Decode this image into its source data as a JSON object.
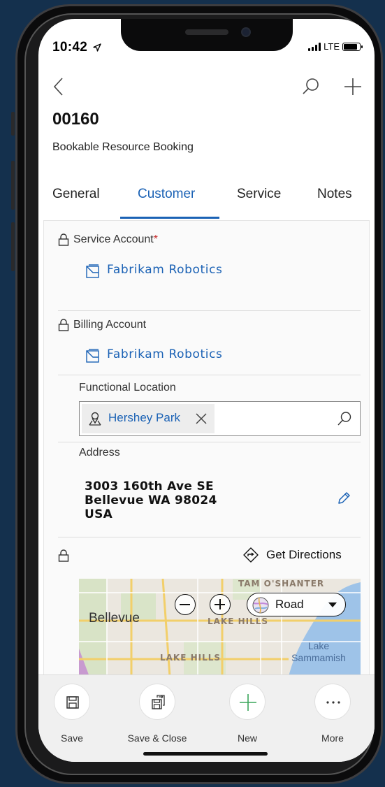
{
  "status_bar": {
    "time": "10:42",
    "network": "LTE",
    "battery_fill": 0.85
  },
  "header": {
    "record_title": "00160",
    "entity_name": "Bookable Resource Booking"
  },
  "tabs": [
    {
      "label": "General"
    },
    {
      "label": "Customer",
      "active": true
    },
    {
      "label": "Service"
    },
    {
      "label": "Notes"
    }
  ],
  "form": {
    "service_account": {
      "label": "Service Account",
      "required_mark": "*",
      "value": "Fabrikam Robotics"
    },
    "billing_account": {
      "label": "Billing Account",
      "value": "Fabrikam Robotics"
    },
    "functional_location": {
      "label": "Functional Location",
      "value": "Hershey Park"
    },
    "address": {
      "label": "Address",
      "line1": "3003 160th Ave SE",
      "line2": "Bellevue WA 98024",
      "line3": "USA"
    },
    "get_directions_label": "Get Directions"
  },
  "map": {
    "labels": {
      "tam_oshanter": "TAM O'SHANTER",
      "lake_hills_1": "LAKE HILLS",
      "lake_hills_2": "LAKE HILLS"
    },
    "city": "Bellevue",
    "lake_line1": "Lake",
    "lake_line2": "Sammamish",
    "style_selected": "Road"
  },
  "command_bar": [
    {
      "label": "Save",
      "icon": "save-icon"
    },
    {
      "label": "Save & Close",
      "icon": "save-close-icon"
    },
    {
      "label": "New",
      "icon": "plus-icon"
    },
    {
      "label": "More",
      "icon": "more-icon"
    }
  ],
  "colors": {
    "accent": "#1b62b5",
    "background": "#14304d",
    "required": "#c62b2b"
  }
}
